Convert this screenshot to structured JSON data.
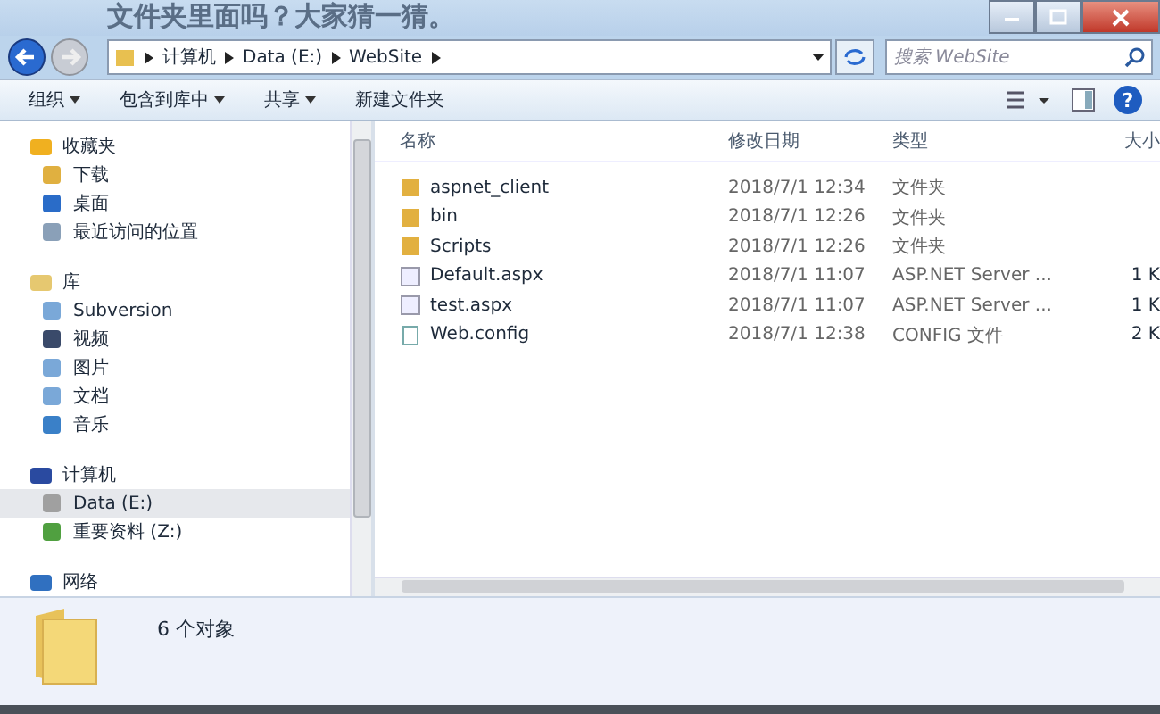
{
  "background_text": "文件夹里面吗？大家猜一猜。",
  "address": {
    "crumbs": [
      "计算机",
      "Data (E:)",
      "WebSite"
    ],
    "search_placeholder": "搜索 WebSite"
  },
  "toolbar": [
    {
      "label": "组织",
      "dropdown": true
    },
    {
      "label": "包含到库中",
      "dropdown": true
    },
    {
      "label": "共享",
      "dropdown": true
    },
    {
      "label": "新建文件夹",
      "dropdown": false
    }
  ],
  "sidebar": {
    "sections": [
      {
        "label": "收藏夹",
        "kind": "star",
        "children": [
          {
            "label": "下载",
            "kind": "download",
            "selected": false
          },
          {
            "label": "桌面",
            "kind": "desktop",
            "selected": false
          },
          {
            "label": "最近访问的位置",
            "kind": "recent",
            "selected": false
          }
        ]
      },
      {
        "label": "库",
        "kind": "library",
        "children": [
          {
            "label": "Subversion",
            "kind": "lib",
            "selected": false
          },
          {
            "label": "视频",
            "kind": "video",
            "selected": false
          },
          {
            "label": "图片",
            "kind": "lib",
            "selected": false
          },
          {
            "label": "文档",
            "kind": "lib",
            "selected": false
          },
          {
            "label": "音乐",
            "kind": "music",
            "selected": false
          }
        ]
      },
      {
        "label": "计算机",
        "kind": "computer",
        "children": [
          {
            "label": "Data (E:)",
            "kind": "drive",
            "selected": true
          },
          {
            "label": "重要资料 (Z:)",
            "kind": "netdrive",
            "selected": false
          }
        ]
      },
      {
        "label": "网络",
        "kind": "network"
      }
    ]
  },
  "table": {
    "columns": [
      "名称",
      "修改日期",
      "类型",
      "大小"
    ],
    "rows": [
      {
        "kind": "folder",
        "name": "aspnet_client",
        "date": "2018/7/1 12:34",
        "type": "文件夹"
      },
      {
        "kind": "folder",
        "name": "bin",
        "date": "2018/7/1 12:26",
        "type": "文件夹"
      },
      {
        "kind": "folder",
        "name": "Scripts",
        "date": "2018/7/1 12:26",
        "type": "文件夹"
      },
      {
        "kind": "page",
        "name": "Default.aspx",
        "date": "2018/7/1 11:07",
        "type": "ASP.NET Server ...",
        "size": "1 K"
      },
      {
        "kind": "page",
        "name": "test.aspx",
        "date": "2018/7/1 11:07",
        "type": "ASP.NET Server ...",
        "size": "1 K"
      },
      {
        "kind": "config",
        "name": "Web.config",
        "date": "2018/7/1 12:38",
        "type": "CONFIG 文件",
        "size": "2 K"
      }
    ]
  },
  "help": "?",
  "status_bar": {
    "count": "6 个对象"
  }
}
